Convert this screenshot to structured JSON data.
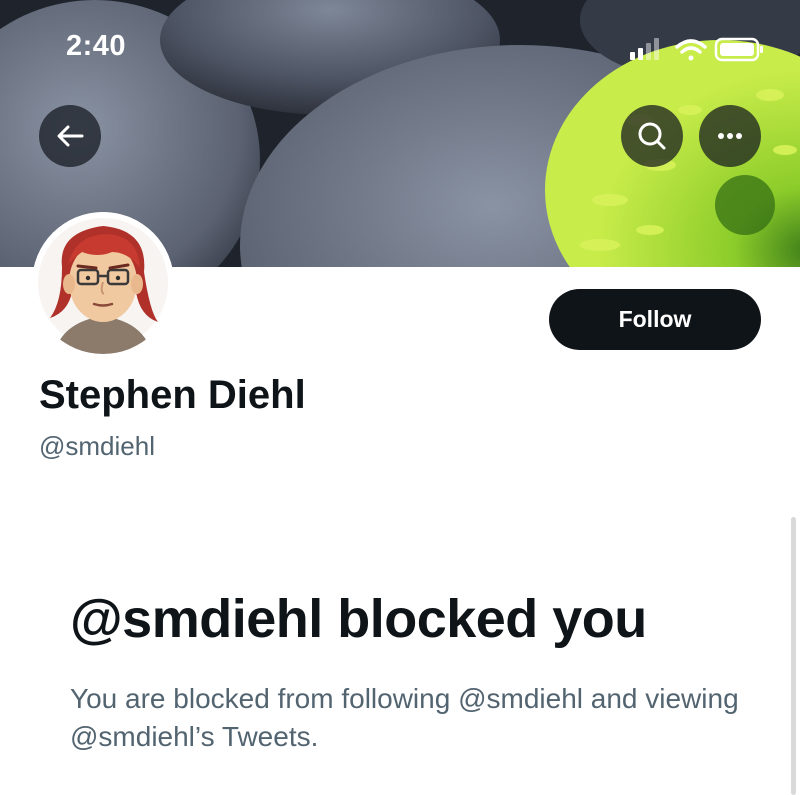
{
  "status_bar": {
    "time": "2:40",
    "icons": [
      "signal-icon",
      "wifi-icon",
      "battery-icon"
    ]
  },
  "header": {
    "buttons": [
      "back-arrow-icon",
      "search-icon",
      "more-icon"
    ]
  },
  "profile": {
    "display_name": "Stephen Diehl",
    "handle": "@smdiehl",
    "follow_label": "Follow"
  },
  "blocked": {
    "title": "@smdiehl blocked you",
    "message": "You are blocked from following @smdiehl and viewing @smdiehl’s Tweets."
  },
  "colors": {
    "text_primary": "#0f1419",
    "text_secondary": "#536471",
    "button_dark": "#0f1419"
  }
}
